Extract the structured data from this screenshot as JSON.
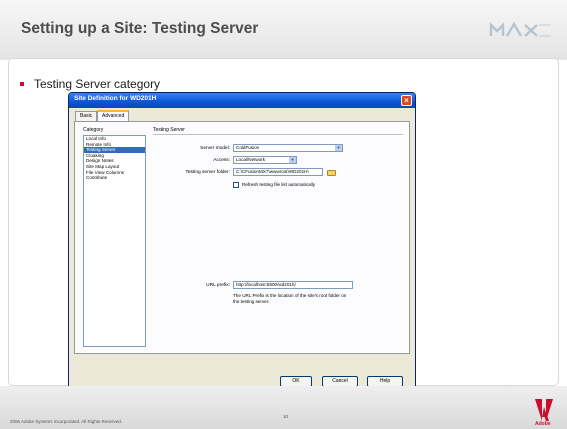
{
  "slide": {
    "title": "Setting up a Site: Testing Server",
    "logo_text": "MAX",
    "bullet": "Testing Server category",
    "copyright": "2006 Adobe Systems Incorporated.  All Rights Reserved.",
    "page_number": "10",
    "adobe_label": "Adobe"
  },
  "dialog": {
    "title": "Site Definition for WD201H",
    "tabs": [
      "Basic",
      "Advanced"
    ],
    "active_tab": "Advanced",
    "category_label": "Category",
    "categories": [
      "Local Info",
      "Remote Info",
      "Testing Server",
      "Cloaking",
      "Design Notes",
      "Site Map Layout",
      "File View Columns",
      "Contribute"
    ],
    "selected_category": "Testing Server",
    "section_title": "Testing Server",
    "server_model_label": "Server model:",
    "server_model_value": "ColdFusion",
    "access_label": "Access:",
    "access_value": "Local/Network",
    "folder_label": "Testing server folder:",
    "folder_value": "C:\\CFusionMX7\\wwwroot\\WD201H\\",
    "refresh_label": "Refresh testing file list automatically",
    "url_prefix_label": "URL prefix:",
    "url_prefix_value": "http://localhost:8500/wd201h/",
    "url_prefix_help": "The URL Prefix is the location of the site's root folder on the testing server.",
    "buttons": {
      "ok": "OK",
      "cancel": "Cancel",
      "help": "Help"
    }
  },
  "colors": {
    "accent": "#c8102e",
    "titlebar": "#0b56d6",
    "selection": "#316ac5"
  }
}
